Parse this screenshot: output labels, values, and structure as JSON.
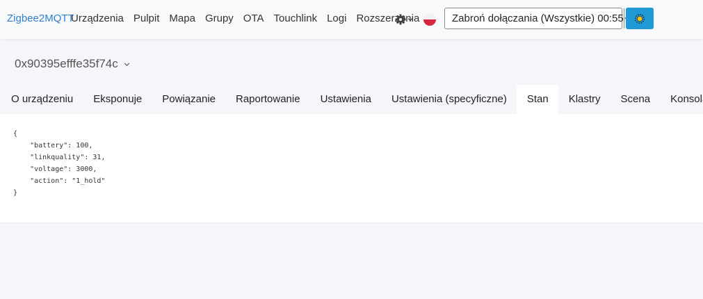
{
  "navbar": {
    "brand": "Zigbee2MQTT",
    "links": [
      "Urządzenia",
      "Pulpit",
      "Mapa",
      "Grupy",
      "OTA",
      "Touchlink",
      "Logi",
      "Rozszerzenia"
    ],
    "permit_join": "Zabroń dołączania (Wszystkie) 00:55",
    "icons": {
      "settings": "gear-icon",
      "language": "poland-flag-icon",
      "theme": "sun-icon"
    }
  },
  "device": {
    "name": "0x90395efffe35f74c"
  },
  "tabs": [
    "O urządzeniu",
    "Eksponuje",
    "Powiązanie",
    "Raportowanie",
    "Ustawienia",
    "Ustawienia (specyficzne)",
    "Stan",
    "Klastry",
    "Scena",
    "Konsola"
  ],
  "active_tab": "Stan",
  "state": {
    "open": "{",
    "lines": [
      "    \"battery\": 100,",
      "    \"linkquality\": 31,",
      "    \"voltage\": 3000,",
      "    \"action\": \"1_hold\""
    ],
    "close": "}"
  },
  "colors": {
    "brand": "#2f7fd1",
    "theme_button": "#1f9ad6",
    "sun": "#f4c20d",
    "flag_red": "#d7263d"
  }
}
